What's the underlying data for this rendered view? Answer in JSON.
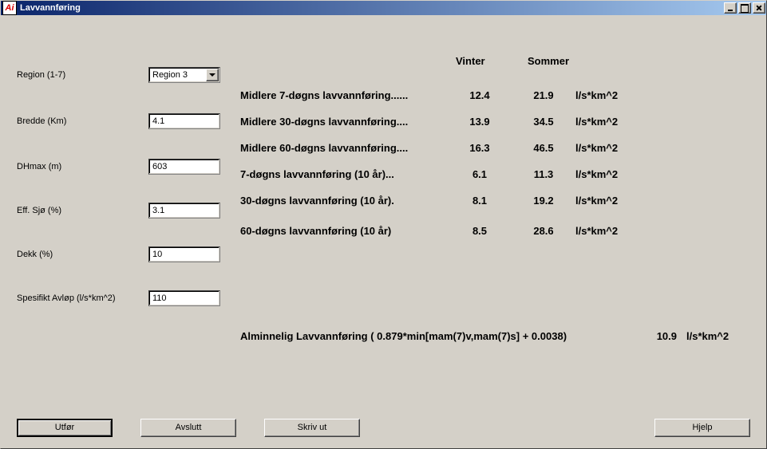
{
  "window": {
    "title": "Lavvannføring",
    "app_icon_text": "Ai"
  },
  "form": {
    "region_label": "Region  (1-7)",
    "region_value": "Region 3",
    "bredde_label": "Bredde (Km)",
    "bredde_value": "4.1",
    "dhmax_label": "DHmax (m)",
    "dhmax_value": "603",
    "effsjo_label": "Eff. Sjø (%)",
    "effsjo_value": "3.1",
    "dekk_label": "Dekk (%)",
    "dekk_value": "10",
    "spesifikt_label": "Spesifikt Avløp (l/s*km^2)",
    "spesifikt_value": "110"
  },
  "headers": {
    "vinter": "Vinter",
    "sommer": "Sommer"
  },
  "rows": [
    {
      "label": "Midlere 7-døgns lavvannføring......",
      "vinter": "12.4",
      "sommer": "21.9",
      "unit": "l/s*km^2"
    },
    {
      "label": "Midlere 30-døgns lavvannføring....",
      "vinter": "13.9",
      "sommer": "34.5",
      "unit": "l/s*km^2"
    },
    {
      "label": "Midlere 60-døgns lavvannføring....",
      "vinter": "16.3",
      "sommer": "46.5",
      "unit": "l/s*km^2"
    },
    {
      "label": "7-døgns lavvannføring (10 år)...",
      "vinter": "6.1",
      "sommer": "11.3",
      "unit": "l/s*km^2"
    },
    {
      "label": "30-døgns lavvannføring (10 år).",
      "vinter": "8.1",
      "sommer": "19.2",
      "unit": "l/s*km^2"
    },
    {
      "label": "60-døgns lavvannføring  (10 år)",
      "vinter": "8.5",
      "sommer": "28.6",
      "unit": "l/s*km^2"
    }
  ],
  "formula": {
    "label": "Alminnelig Lavvannføring  ( 0.879*min[mam(7)v,mam(7)s] + 0.0038)",
    "value": "10.9",
    "unit": "l/s*km^2"
  },
  "buttons": {
    "utfor": "Utfør",
    "avslutt": "Avslutt",
    "skrivut": "Skriv ut",
    "hjelp": "Hjelp"
  }
}
